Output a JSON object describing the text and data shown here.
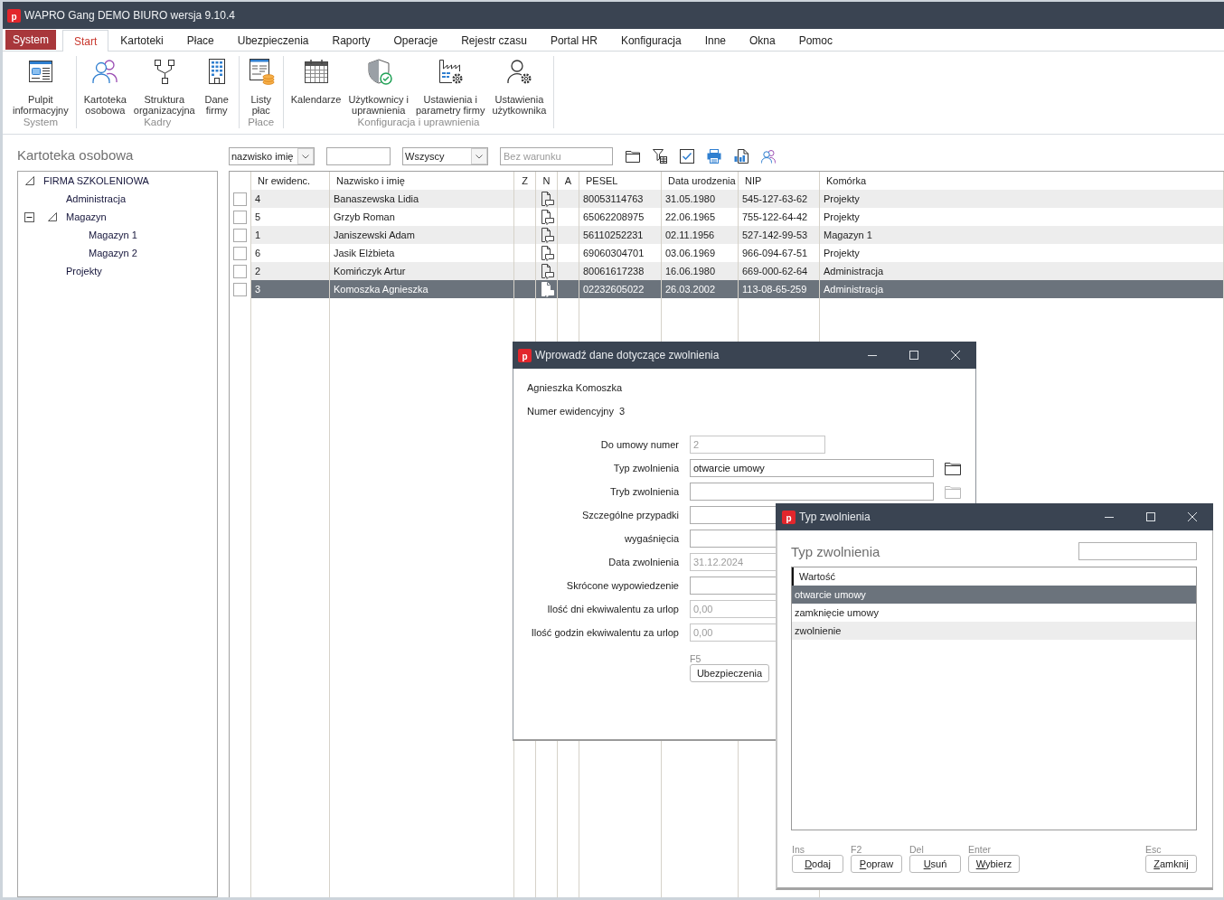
{
  "window": {
    "title": "WAPRO Gang DEMO BIURO wersja 9.10.4",
    "logo": "p"
  },
  "menu": [
    {
      "label": "System",
      "kind": "app",
      "selected": false
    },
    {
      "label": "Start",
      "kind": "tab",
      "selected": true
    },
    {
      "label": "Kartoteki",
      "kind": "tab",
      "selected": false
    },
    {
      "label": "Płace",
      "kind": "tab",
      "selected": false
    },
    {
      "label": "Ubezpieczenia",
      "kind": "tab",
      "selected": false
    },
    {
      "label": "Raporty",
      "kind": "tab",
      "selected": false
    },
    {
      "label": "Operacje",
      "kind": "tab",
      "selected": false
    },
    {
      "label": "Rejestr czasu",
      "kind": "tab",
      "selected": false
    },
    {
      "label": "Portal HR",
      "kind": "tab",
      "selected": false
    },
    {
      "label": "Konfiguracja",
      "kind": "tab",
      "selected": false
    },
    {
      "label": "Inne",
      "kind": "tab",
      "selected": false
    },
    {
      "label": "Okna",
      "kind": "tab",
      "selected": false
    },
    {
      "label": "Pomoc",
      "kind": "tab",
      "selected": false
    }
  ],
  "ribbon": [
    {
      "group": "System",
      "items": [
        {
          "label": "Pulpit\ninformacyjny",
          "kind": "dashboard"
        }
      ]
    },
    {
      "group": "Kadry",
      "items": [
        {
          "label": "Kartoteka\nosobowa",
          "kind": "people"
        },
        {
          "label": "Struktura\norganizacyjna",
          "kind": "orgchart"
        },
        {
          "label": "Dane\nfirmy",
          "kind": "building"
        }
      ]
    },
    {
      "group": "Płace",
      "items": [
        {
          "label": "Listy\npłac",
          "kind": "payroll"
        }
      ]
    },
    {
      "group": "Konfiguracja i uprawnienia",
      "items": [
        {
          "label": "Kalendarze",
          "kind": "calendar"
        },
        {
          "label": "Użytkownicy i\nuprawnienia",
          "kind": "shield"
        },
        {
          "label": "Ustawienia i\nparametry firmy",
          "kind": "factory"
        },
        {
          "label": "Ustawienia\nużytkownika",
          "kind": "usergear"
        }
      ]
    }
  ],
  "panel": {
    "title": "Kartoteka osobowa"
  },
  "tree": [
    {
      "label": "FIRMA SZKOLENIOWA",
      "expanded": true,
      "children": [
        {
          "label": "Administracja"
        },
        {
          "label": "Magazyn",
          "expanded": true,
          "children": [
            {
              "label": "Magazyn 1"
            },
            {
              "label": "Magazyn 2"
            }
          ]
        },
        {
          "label": "Projekty"
        }
      ]
    }
  ],
  "filters": {
    "sort": "nazwisko imię",
    "group": "Wszyscy",
    "condition_placeholder": "Bez warunku"
  },
  "table": {
    "columns": [
      "Nr ewidenc.",
      "Nazwisko i imię",
      "Z",
      "N",
      "A",
      "PESEL",
      "Data urodzenia",
      "NIP",
      "Komórka"
    ],
    "rows": [
      {
        "checked": false,
        "selected": false,
        "nr": "4",
        "name": "Banaszewska Lidia",
        "note": true,
        "pesel": "80053114763",
        "birth_date": "31.05.1980",
        "nip": "545-127-63-62",
        "unit": "Projekty"
      },
      {
        "checked": false,
        "selected": false,
        "nr": "5",
        "name": "Grzyb Roman",
        "note": true,
        "pesel": "65062208975",
        "birth_date": "22.06.1965",
        "nip": "755-122-64-42",
        "unit": "Projekty"
      },
      {
        "checked": false,
        "selected": false,
        "nr": "1",
        "name": "Janiszewski Adam",
        "note": true,
        "pesel": "56110252231",
        "birth_date": "02.11.1956",
        "nip": "527-142-99-53",
        "unit": "Magazyn 1"
      },
      {
        "checked": false,
        "selected": false,
        "nr": "6",
        "name": "Jasik Elżbieta",
        "note": true,
        "pesel": "69060304701",
        "birth_date": "03.06.1969",
        "nip": "966-094-67-51",
        "unit": "Projekty"
      },
      {
        "checked": false,
        "selected": false,
        "nr": "2",
        "name": "Komińczyk Artur",
        "note": true,
        "pesel": "80061617238",
        "birth_date": "16.06.1980",
        "nip": "669-000-62-64",
        "unit": "Administracja"
      },
      {
        "checked": false,
        "selected": true,
        "nr": "3",
        "name": "Komoszka Agnieszka",
        "note": true,
        "pesel": "02232605022",
        "birth_date": "26.03.2002",
        "nip": "113-08-65-259",
        "unit": "Administracja"
      }
    ]
  },
  "release_dialog": {
    "title": "Wprowadź dane dotyczące zwolnienia",
    "logo": "p",
    "employee": "Agnieszka Komoszka",
    "number_label": "Numer ewidencyjny",
    "number": "3",
    "fields": [
      {
        "label": "Do umowy numer",
        "value": "2",
        "disabled": true,
        "kind": "number"
      },
      {
        "label": "Typ zwolnienia",
        "value": "otwarcie umowy",
        "disabled": false,
        "kind": "picker",
        "picker": {
          "disabled": false
        }
      },
      {
        "label": "Tryb zwolnienia",
        "disabled": false,
        "kind": "picker",
        "picker": {
          "disabled": true
        }
      },
      {
        "label": "Szczególne przypadki",
        "disabled": false,
        "kind": "text"
      },
      {
        "label": "wygaśnięcia",
        "disabled": false,
        "kind": "text"
      },
      {
        "label": "Data zwolnienia",
        "value": "31.12.2024",
        "disabled": true,
        "kind": "text"
      },
      {
        "label": "Skrócone wypowiedzenie",
        "disabled": false,
        "kind": "text"
      },
      {
        "label": "Ilość dni ekwiwalentu za urlop",
        "value": "0,00",
        "disabled": true,
        "kind": "text"
      },
      {
        "label": "Ilość godzin ekwiwalentu za urlop",
        "value": "0,00",
        "disabled": true,
        "kind": "text"
      }
    ],
    "button": {
      "label": "Ubezpieczenia",
      "shortcut": "F5"
    }
  },
  "type_dialog": {
    "title": "Typ zwolnienia",
    "logo": "p",
    "heading": "Typ zwolnienia",
    "column": "Wartość",
    "rows": [
      {
        "label": "otwarcie umowy",
        "selected": true
      },
      {
        "label": "zamknięcie umowy",
        "selected": false
      },
      {
        "label": "zwolnienie",
        "selected": false
      }
    ],
    "buttons": [
      {
        "label": "Dodaj",
        "shortcut": "Ins",
        "kind": "action"
      },
      {
        "label": "Popraw",
        "shortcut": "F2",
        "kind": "action"
      },
      {
        "label": "Usuń",
        "shortcut": "Del",
        "kind": "action"
      },
      {
        "label": "Wybierz",
        "shortcut": "Enter",
        "kind": "action"
      },
      {
        "label": "Zamknij",
        "shortcut": "Esc",
        "kind": "close"
      }
    ]
  }
}
